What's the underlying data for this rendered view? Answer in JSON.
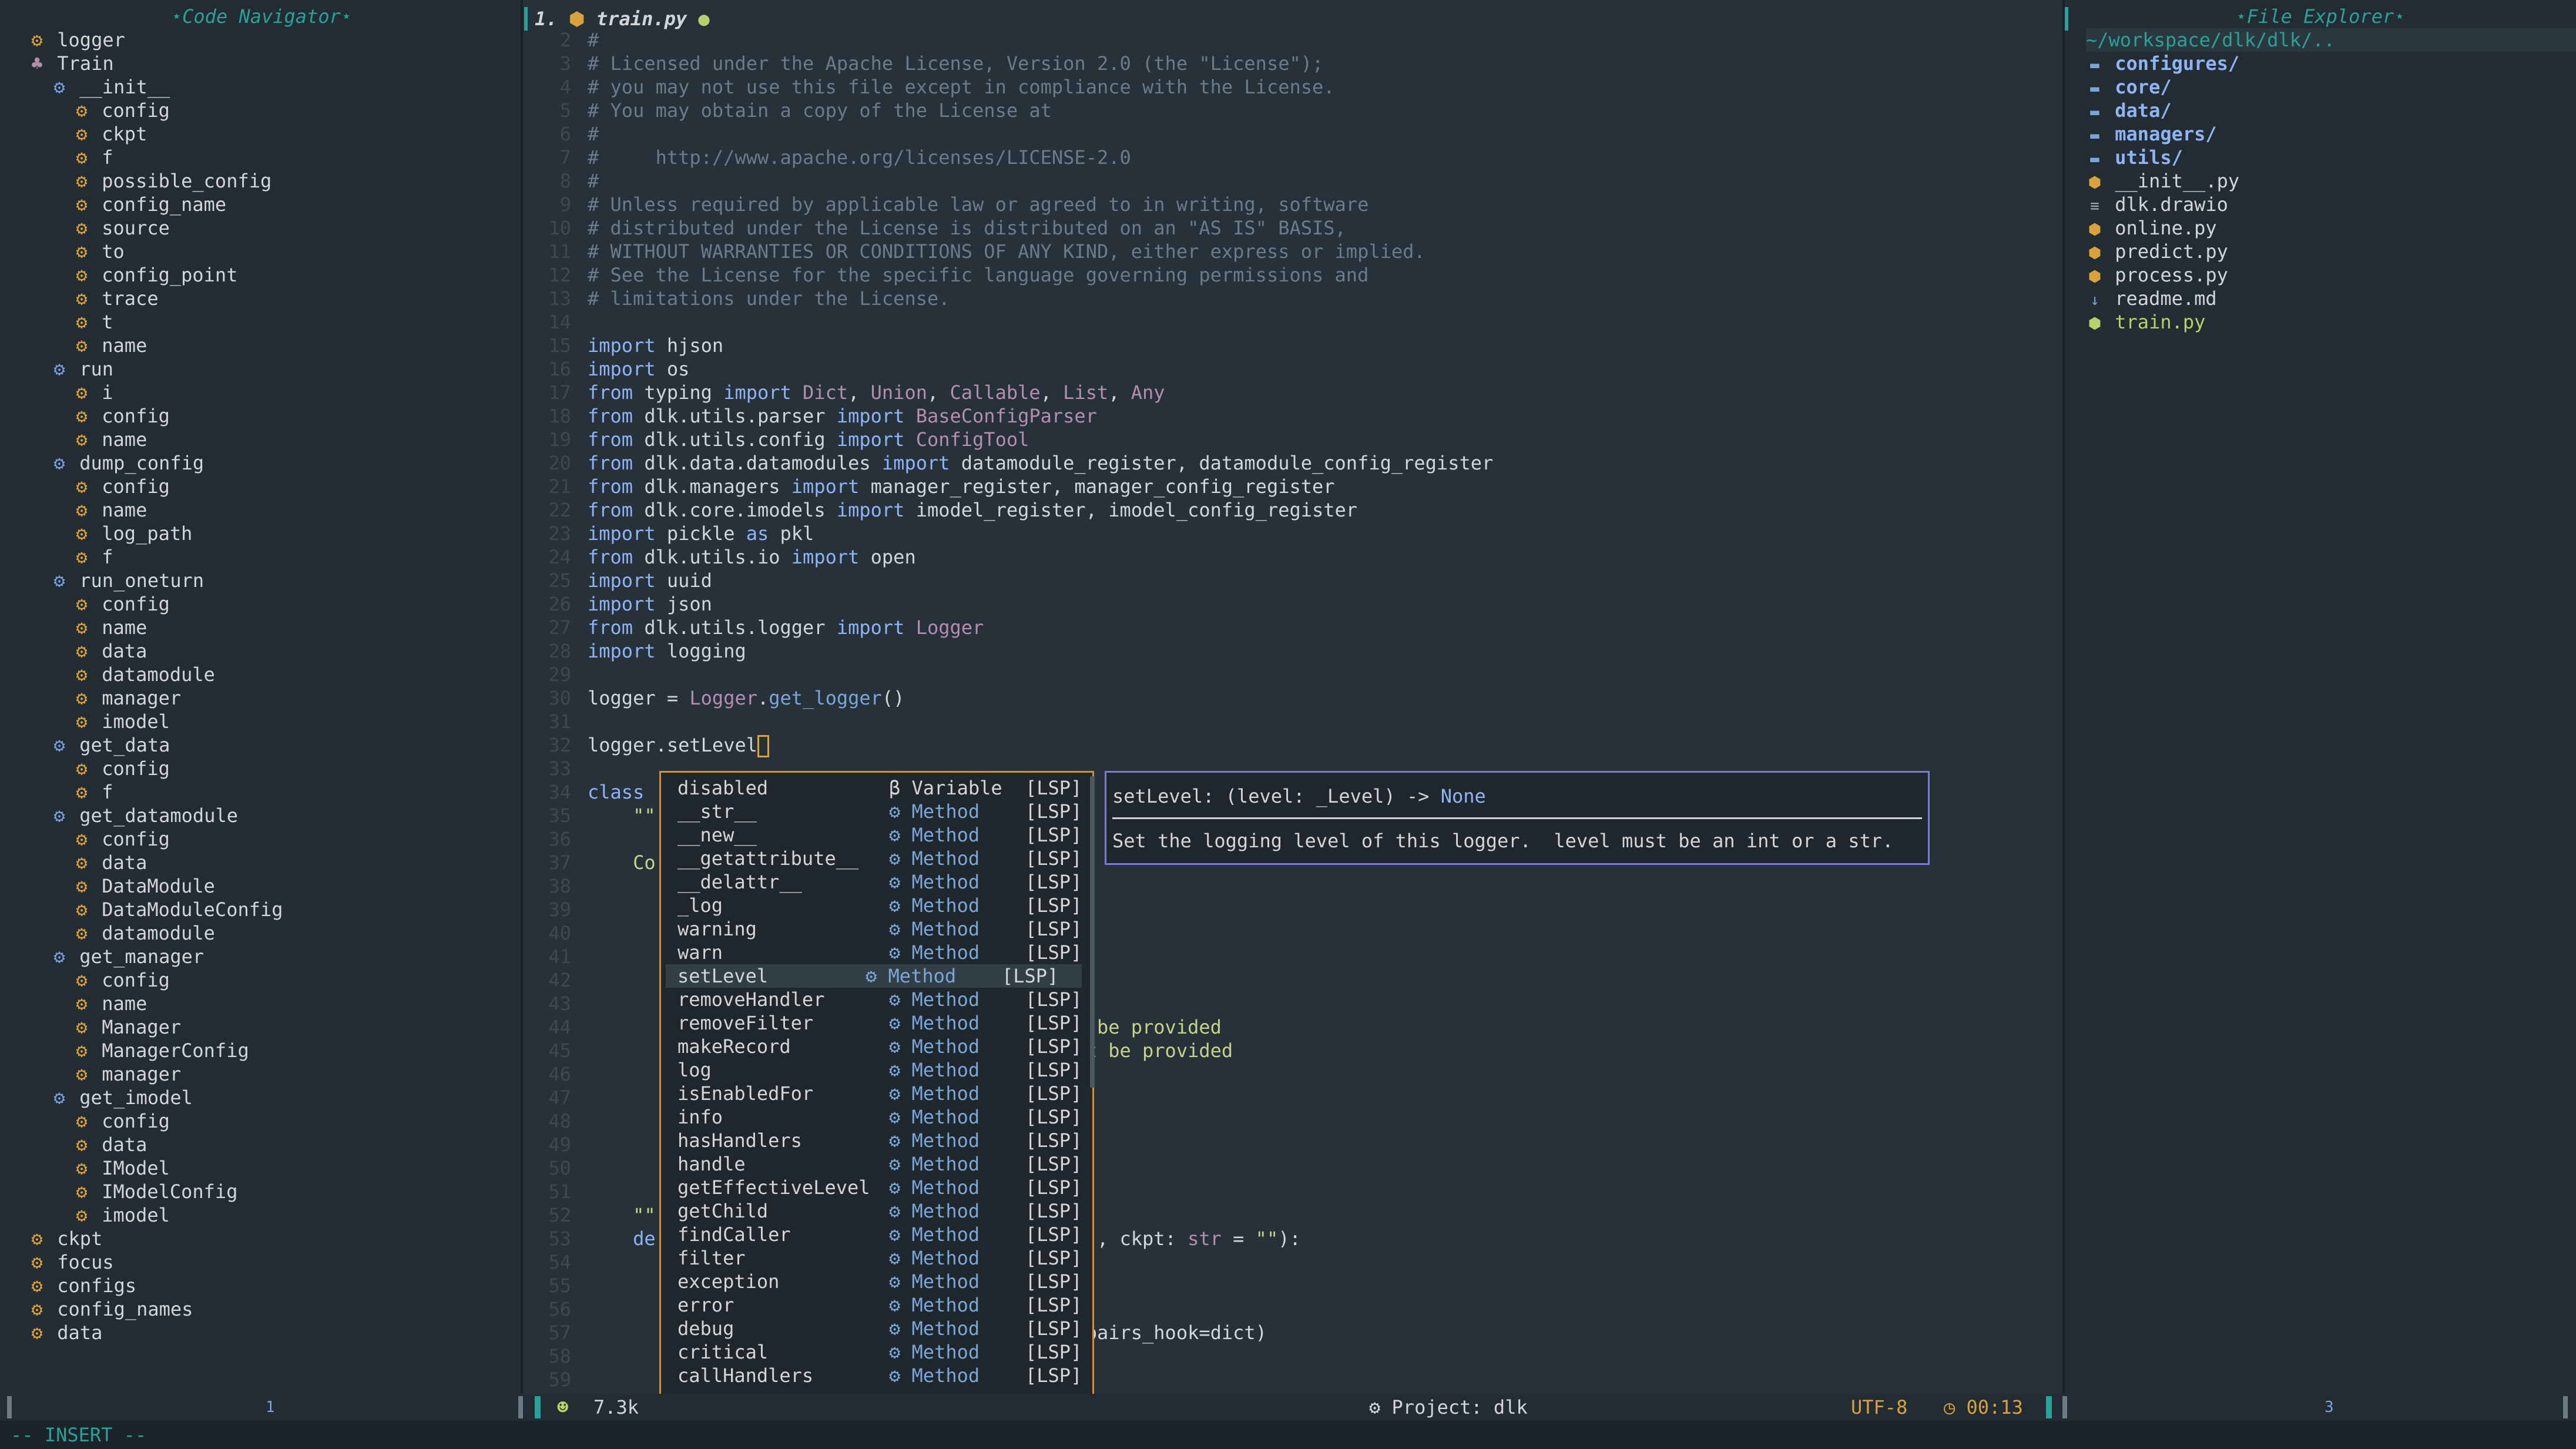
{
  "left_panel": {
    "title": "⋆Code Navigator⋆",
    "items": [
      {
        "label": "logger",
        "kind": "var",
        "depth": 0
      },
      {
        "label": "Train",
        "kind": "class",
        "depth": 0
      },
      {
        "label": "__init__",
        "kind": "fn",
        "depth": 1
      },
      {
        "label": "config",
        "kind": "var",
        "depth": 2
      },
      {
        "label": "ckpt",
        "kind": "var",
        "depth": 2
      },
      {
        "label": "f",
        "kind": "var",
        "depth": 2
      },
      {
        "label": "possible_config",
        "kind": "var",
        "depth": 2
      },
      {
        "label": "config_name",
        "kind": "var",
        "depth": 2
      },
      {
        "label": "source",
        "kind": "var",
        "depth": 2
      },
      {
        "label": "to",
        "kind": "var",
        "depth": 2
      },
      {
        "label": "config_point",
        "kind": "var",
        "depth": 2
      },
      {
        "label": "trace",
        "kind": "var",
        "depth": 2
      },
      {
        "label": "t",
        "kind": "var",
        "depth": 2
      },
      {
        "label": "name",
        "kind": "var",
        "depth": 2
      },
      {
        "label": "run",
        "kind": "fn",
        "depth": 1
      },
      {
        "label": "i",
        "kind": "var",
        "depth": 2
      },
      {
        "label": "config",
        "kind": "var",
        "depth": 2
      },
      {
        "label": "name",
        "kind": "var",
        "depth": 2
      },
      {
        "label": "dump_config",
        "kind": "fn",
        "depth": 1
      },
      {
        "label": "config",
        "kind": "var",
        "depth": 2
      },
      {
        "label": "name",
        "kind": "var",
        "depth": 2
      },
      {
        "label": "log_path",
        "kind": "var",
        "depth": 2
      },
      {
        "label": "f",
        "kind": "var",
        "depth": 2
      },
      {
        "label": "run_oneturn",
        "kind": "fn",
        "depth": 1
      },
      {
        "label": "config",
        "kind": "var",
        "depth": 2
      },
      {
        "label": "name",
        "kind": "var",
        "depth": 2
      },
      {
        "label": "data",
        "kind": "var",
        "depth": 2
      },
      {
        "label": "datamodule",
        "kind": "var",
        "depth": 2
      },
      {
        "label": "manager",
        "kind": "var",
        "depth": 2
      },
      {
        "label": "imodel",
        "kind": "var",
        "depth": 2
      },
      {
        "label": "get_data",
        "kind": "fn",
        "depth": 1
      },
      {
        "label": "config",
        "kind": "var",
        "depth": 2
      },
      {
        "label": "f",
        "kind": "var",
        "depth": 2
      },
      {
        "label": "get_datamodule",
        "kind": "fn",
        "depth": 1
      },
      {
        "label": "config",
        "kind": "var",
        "depth": 2
      },
      {
        "label": "data",
        "kind": "var",
        "depth": 2
      },
      {
        "label": "DataModule",
        "kind": "var",
        "depth": 2
      },
      {
        "label": "DataModuleConfig",
        "kind": "var",
        "depth": 2
      },
      {
        "label": "datamodule",
        "kind": "var",
        "depth": 2
      },
      {
        "label": "get_manager",
        "kind": "fn",
        "depth": 1
      },
      {
        "label": "config",
        "kind": "var",
        "depth": 2
      },
      {
        "label": "name",
        "kind": "var",
        "depth": 2
      },
      {
        "label": "Manager",
        "kind": "var",
        "depth": 2
      },
      {
        "label": "ManagerConfig",
        "kind": "var",
        "depth": 2
      },
      {
        "label": "manager",
        "kind": "var",
        "depth": 2
      },
      {
        "label": "get_imodel",
        "kind": "fn",
        "depth": 1
      },
      {
        "label": "config",
        "kind": "var",
        "depth": 2
      },
      {
        "label": "data",
        "kind": "var",
        "depth": 2
      },
      {
        "label": "IModel",
        "kind": "var",
        "depth": 2
      },
      {
        "label": "IModelConfig",
        "kind": "var",
        "depth": 2
      },
      {
        "label": "imodel",
        "kind": "var",
        "depth": 2
      },
      {
        "label": "ckpt",
        "kind": "var",
        "depth": 0
      },
      {
        "label": "focus",
        "kind": "var",
        "depth": 0
      },
      {
        "label": "configs",
        "kind": "var",
        "depth": 0
      },
      {
        "label": "config_names",
        "kind": "var",
        "depth": 0
      },
      {
        "label": "data",
        "kind": "var",
        "depth": 0
      }
    ],
    "status_badge": "1"
  },
  "tab": {
    "index": "1.",
    "filename": "train.py",
    "modified_dot": "●"
  },
  "editor": {
    "lines": [
      {
        "n": "2",
        "html": "<span class='c'>#</span>"
      },
      {
        "n": "3",
        "html": "<span class='c'># Licensed under the Apache License, Version 2.0 (the \"License\");</span>"
      },
      {
        "n": "4",
        "html": "<span class='c'># you may not use this file except in compliance with the License.</span>"
      },
      {
        "n": "5",
        "html": "<span class='c'># You may obtain a copy of the License at</span>"
      },
      {
        "n": "6",
        "html": "<span class='c'>#</span>"
      },
      {
        "n": "7",
        "html": "<span class='c'>#     http://www.apache.org/licenses/LICENSE-2.0</span>"
      },
      {
        "n": "8",
        "html": "<span class='c'>#</span>"
      },
      {
        "n": "9",
        "html": "<span class='c'># Unless required by applicable law or agreed to in writing, software</span>"
      },
      {
        "n": "10",
        "html": "<span class='c'># distributed under the License is distributed on an \"AS IS\" BASIS,</span>"
      },
      {
        "n": "11",
        "html": "<span class='c'># WITHOUT WARRANTIES OR CONDITIONS OF ANY KIND, either express or implied.</span>"
      },
      {
        "n": "12",
        "html": "<span class='c'># See the License for the specific language governing permissions and</span>"
      },
      {
        "n": "13",
        "html": "<span class='c'># limitations under the License.</span>"
      },
      {
        "n": "14",
        "html": ""
      },
      {
        "n": "15",
        "html": "<span class='k'>import</span> hjson"
      },
      {
        "n": "16",
        "html": "<span class='k'>import</span> os"
      },
      {
        "n": "17",
        "html": "<span class='k'>from</span> typing <span class='k'>import</span> <span class='t'>Dict</span>, <span class='t'>Union</span>, <span class='t'>Callable</span>, <span class='t'>List</span>, <span class='t'>Any</span>"
      },
      {
        "n": "18",
        "html": "<span class='k'>from</span> dlk.utils.parser <span class='k'>import</span> <span class='t'>BaseConfigParser</span>"
      },
      {
        "n": "19",
        "html": "<span class='k'>from</span> dlk.utils.config <span class='k'>import</span> <span class='t'>ConfigTool</span>"
      },
      {
        "n": "20",
        "html": "<span class='k'>from</span> dlk.data.datamodules <span class='k'>import</span> datamodule_register, datamodule_config_register"
      },
      {
        "n": "21",
        "html": "<span class='k'>from</span> dlk.managers <span class='k'>import</span> manager_register, manager_config_register"
      },
      {
        "n": "22",
        "html": "<span class='k'>from</span> dlk.core.imodels <span class='k'>import</span> imodel_register, imodel_config_register"
      },
      {
        "n": "23",
        "html": "<span class='k'>import</span> pickle <span class='k'>as</span> pkl"
      },
      {
        "n": "24",
        "html": "<span class='k'>from</span> dlk.utils.io <span class='k'>import</span> open"
      },
      {
        "n": "25",
        "html": "<span class='k'>import</span> uuid"
      },
      {
        "n": "26",
        "html": "<span class='k'>import</span> json"
      },
      {
        "n": "27",
        "html": "<span class='k'>from</span> dlk.utils.logger <span class='k'>import</span> <span class='t'>Logger</span>"
      },
      {
        "n": "28",
        "html": "<span class='k'>import</span> logging"
      },
      {
        "n": "29",
        "html": ""
      },
      {
        "n": "30",
        "html": "logger = <span class='t'>Logger</span>.<span class='f'>get_logger</span>()"
      },
      {
        "n": "31",
        "html": ""
      },
      {
        "n": "32",
        "html": "logger.setLevel<span style='border:3px solid #d9a23c;display:inline-block;width:20px;height:38px;vertical-align:middle'></span>"
      },
      {
        "n": "33",
        "html": ""
      },
      {
        "n": "34",
        "html": "<span class='k'>class</span>"
      },
      {
        "n": "35",
        "html": "    <span class='s'>\"\"</span>"
      },
      {
        "n": "36",
        "html": ""
      },
      {
        "n": "37",
        "html": "    <span class='s'>Co</span>"
      },
      {
        "n": "38",
        "html": ""
      },
      {
        "n": "39",
        "html": ""
      },
      {
        "n": "40",
        "html": ""
      },
      {
        "n": "41",
        "html": ""
      },
      {
        "n": "42",
        "html": ""
      },
      {
        "n": "43",
        "html": ""
      },
      {
        "n": "44",
        "html": "                                          <span class='s'>st be provided</span>"
      },
      {
        "n": "45",
        "html": "                                          <span class='s'>ust be provided</span>"
      },
      {
        "n": "46",
        "html": ""
      },
      {
        "n": "47",
        "html": ""
      },
      {
        "n": "48",
        "html": ""
      },
      {
        "n": "49",
        "html": ""
      },
      {
        "n": "50",
        "html": ""
      },
      {
        "n": "51",
        "html": ""
      },
      {
        "n": "52",
        "html": "    <span class='s'>\"\"</span>"
      },
      {
        "n": "53",
        "html": "    <span class='k'>de</span>                                    ct], ckpt: <span class='t'>str</span> = <span class='s'>\"\"</span>):"
      },
      {
        "n": "54",
        "html": ""
      },
      {
        "n": "55",
        "html": ""
      },
      {
        "n": "56",
        "html": ""
      },
      {
        "n": "57",
        "html": "                                          t_pairs_hook=dict)"
      },
      {
        "n": "58",
        "html": ""
      },
      {
        "n": "59",
        "html": ""
      }
    ]
  },
  "completion": {
    "items": [
      {
        "name": "disabled",
        "kind": "Variable",
        "icon": "β",
        "src": "[LSP]"
      },
      {
        "name": "__str__",
        "kind": "Method",
        "icon": "⚙",
        "src": "[LSP]"
      },
      {
        "name": "__new__",
        "kind": "Method",
        "icon": "⚙",
        "src": "[LSP]"
      },
      {
        "name": "__getattribute__",
        "kind": "Method",
        "icon": "⚙",
        "src": "[LSP]"
      },
      {
        "name": "__delattr__",
        "kind": "Method",
        "icon": "⚙",
        "src": "[LSP]"
      },
      {
        "name": "_log",
        "kind": "Method",
        "icon": "⚙",
        "src": "[LSP]"
      },
      {
        "name": "warning",
        "kind": "Method",
        "icon": "⚙",
        "src": "[LSP]"
      },
      {
        "name": "warn",
        "kind": "Method",
        "icon": "⚙",
        "src": "[LSP]"
      },
      {
        "name": "setLevel",
        "kind": "Method",
        "icon": "⚙",
        "src": "[LSP]",
        "selected": true
      },
      {
        "name": "removeHandler",
        "kind": "Method",
        "icon": "⚙",
        "src": "[LSP]"
      },
      {
        "name": "removeFilter",
        "kind": "Method",
        "icon": "⚙",
        "src": "[LSP]"
      },
      {
        "name": "makeRecord",
        "kind": "Method",
        "icon": "⚙",
        "src": "[LSP]"
      },
      {
        "name": "log",
        "kind": "Method",
        "icon": "⚙",
        "src": "[LSP]"
      },
      {
        "name": "isEnabledFor",
        "kind": "Method",
        "icon": "⚙",
        "src": "[LSP]"
      },
      {
        "name": "info",
        "kind": "Method",
        "icon": "⚙",
        "src": "[LSP]"
      },
      {
        "name": "hasHandlers",
        "kind": "Method",
        "icon": "⚙",
        "src": "[LSP]"
      },
      {
        "name": "handle",
        "kind": "Method",
        "icon": "⚙",
        "src": "[LSP]"
      },
      {
        "name": "getEffectiveLevel",
        "kind": "Method",
        "icon": "⚙",
        "src": "[LSP]"
      },
      {
        "name": "getChild",
        "kind": "Method",
        "icon": "⚙",
        "src": "[LSP]"
      },
      {
        "name": "findCaller",
        "kind": "Method",
        "icon": "⚙",
        "src": "[LSP]"
      },
      {
        "name": "filter",
        "kind": "Method",
        "icon": "⚙",
        "src": "[LSP]"
      },
      {
        "name": "exception",
        "kind": "Method",
        "icon": "⚙",
        "src": "[LSP]"
      },
      {
        "name": "error",
        "kind": "Method",
        "icon": "⚙",
        "src": "[LSP]"
      },
      {
        "name": "debug",
        "kind": "Method",
        "icon": "⚙",
        "src": "[LSP]"
      },
      {
        "name": "critical",
        "kind": "Method",
        "icon": "⚙",
        "src": "[LSP]"
      },
      {
        "name": "callHandlers",
        "kind": "Method",
        "icon": "⚙",
        "src": "[LSP]"
      }
    ]
  },
  "signature": {
    "sig_prefix": "setLevel: (level: _Level) -> ",
    "sig_ret": "None",
    "doc": "Set the logging level of this logger.  level must be an int or a str."
  },
  "right_panel": {
    "title": "⋆File Explorer⋆",
    "path": "~/workspace/dlk/dlk/..",
    "items": [
      {
        "label": "configures/",
        "kind": "dir"
      },
      {
        "label": "core/",
        "kind": "dir"
      },
      {
        "label": "data/",
        "kind": "dir"
      },
      {
        "label": "managers/",
        "kind": "dir"
      },
      {
        "label": "utils/",
        "kind": "dir"
      },
      {
        "label": "__init__.py",
        "kind": "py"
      },
      {
        "label": "dlk.drawio",
        "kind": "txt"
      },
      {
        "label": "online.py",
        "kind": "py"
      },
      {
        "label": "predict.py",
        "kind": "py"
      },
      {
        "label": "process.py",
        "kind": "py"
      },
      {
        "label": "readme.md",
        "kind": "md"
      },
      {
        "label": "train.py",
        "kind": "pyactive"
      }
    ],
    "status_badge": "3"
  },
  "status": {
    "filesize": "7.3k",
    "project": "Project: dlk",
    "encoding": "UTF-8",
    "time": "00:13",
    "mode": "-- INSERT --"
  },
  "colors": {
    "accent": "#2aa198",
    "popup_border": "#d98f2c",
    "sig_border": "#7a7ad8",
    "dir": "#8fb4f5",
    "py": "#d9a23c"
  }
}
